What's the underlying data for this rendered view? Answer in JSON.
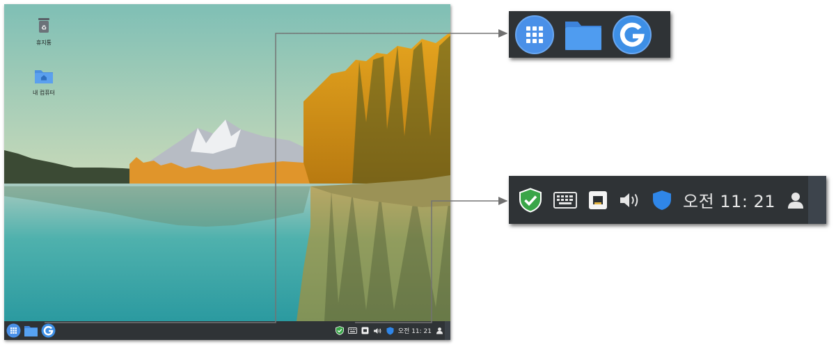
{
  "desktop": {
    "icons": [
      {
        "name": "trash",
        "label": "휴지통"
      },
      {
        "name": "home",
        "label": "내 컴퓨터"
      }
    ]
  },
  "taskbar": {
    "apps": [
      {
        "name": "app-menu-icon",
        "title": "Applications"
      },
      {
        "name": "folder-icon",
        "title": "Files"
      },
      {
        "name": "browser-g-icon",
        "title": "Browser"
      }
    ],
    "tray": {
      "icons": [
        "shield-check-icon",
        "keyboard-icon",
        "network-icon",
        "volume-icon",
        "security-shield-icon",
        "user-icon"
      ],
      "clock": "오전 11: 21"
    }
  },
  "zoom": {
    "top_apps": [
      "app-menu-icon",
      "folder-icon",
      "browser-g-icon"
    ],
    "tray_clock": "오전 11: 21"
  },
  "colors": {
    "taskbar": "#2f3336",
    "app_blue": "#4a90e8",
    "folder_blue": "#4f9cf0",
    "shield_green": "#3aa548",
    "security_blue": "#2f86e8",
    "connector": "#6e6e6e"
  }
}
